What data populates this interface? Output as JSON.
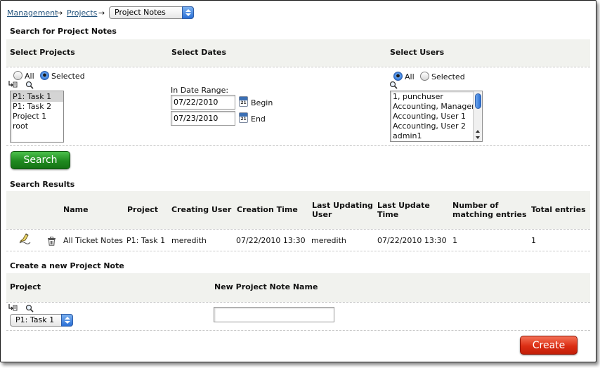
{
  "breadcrumb": {
    "management": "Management",
    "projects": "Projects",
    "arrow": "→",
    "current": "Project Notes"
  },
  "search_section": {
    "title": "Search for Project Notes",
    "projects": {
      "label": "Select Projects",
      "radio_all": "All",
      "radio_selected": "Selected",
      "selected_mode": "Selected",
      "items": [
        "P1: Task 1",
        "P1: Task 2",
        "Project 1",
        "root"
      ],
      "selected_item": "P1: Task 1"
    },
    "dates": {
      "label": "Select Dates",
      "range_label": "In Date Range:",
      "begin_value": "07/22/2010",
      "begin_label": "Begin",
      "end_value": "07/23/2010",
      "end_label": "End",
      "calendar_glyph": "21"
    },
    "users": {
      "label": "Select Users",
      "radio_all": "All",
      "radio_selected": "Selected",
      "selected_mode": "All",
      "items": [
        "1, punchuser",
        "Accounting, Manager",
        "Accounting, User 1",
        "Accounting, User 2",
        "admin1"
      ]
    },
    "search_button": "Search"
  },
  "results": {
    "title": "Search Results",
    "columns": {
      "name": "Name",
      "project": "Project",
      "creating_user": "Creating User",
      "creation_time": "Creation Time",
      "last_updating_user_1": "Last Updating",
      "last_updating_user_2": "User",
      "last_update_time_1": "Last Update",
      "last_update_time_2": "Time",
      "matching_1": "Number of",
      "matching_2": "matching entries",
      "total": "Total entries"
    },
    "rows": [
      {
        "name": "All Ticket Notes",
        "project": "P1: Task 1",
        "creating_user": "meredith",
        "creation_time": "07/22/2010 13:30",
        "last_updating_user": "meredith",
        "last_update_time": "07/22/2010 13:30",
        "matching": "1",
        "total": "1"
      }
    ]
  },
  "create_section": {
    "title": "Create a new Project Note",
    "project_label": "Project",
    "name_label": "New Project Note Name",
    "project_value": "P1: Task 1",
    "name_value": "",
    "create_button": "Create"
  },
  "icons": {
    "tree": "tree-select-icon",
    "magnifier": "magnifier-icon",
    "edit": "edit-note-icon",
    "trash": "trash-icon",
    "calendar": "calendar-icon"
  },
  "colors": {
    "link": "#23537d",
    "band": "#f1f2ee",
    "search_green": "#1f8a1f",
    "create_red": "#dc2e14",
    "select_blue": "#2a6fd6"
  }
}
